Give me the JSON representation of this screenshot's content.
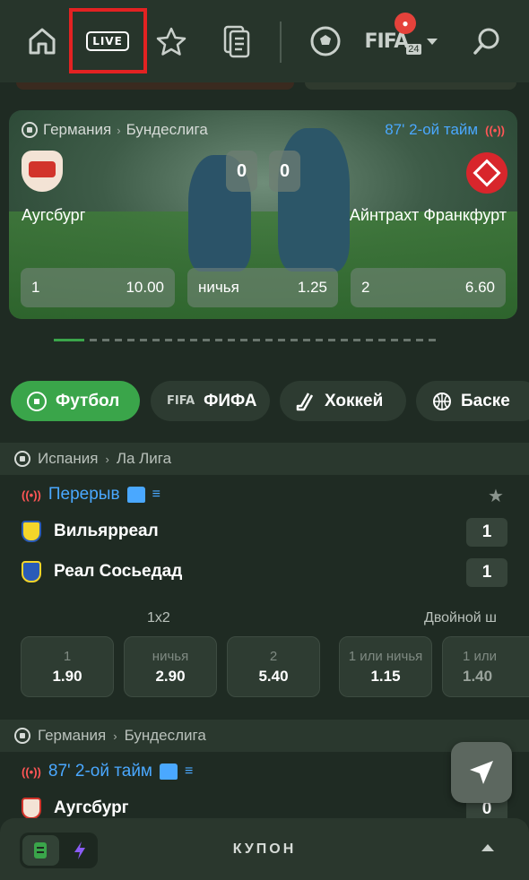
{
  "nav": {
    "live_label": "LIVE",
    "fifa_label": "FIFA",
    "fifa_year": "24"
  },
  "featured": {
    "country": "Германия",
    "league": "Бундеслига",
    "status": "87' 2-ой тайм",
    "home_team": "Аугсбург",
    "away_team": "Айнтрахт Франкфурт",
    "home_score": "0",
    "away_score": "0",
    "odds": [
      {
        "label": "1",
        "value": "10.00"
      },
      {
        "label": "ничья",
        "value": "1.25"
      },
      {
        "label": "2",
        "value": "6.60"
      }
    ]
  },
  "sport_tabs": [
    {
      "label": "Футбол",
      "active": true
    },
    {
      "label": "ФИФА",
      "active": false
    },
    {
      "label": "Хоккей",
      "active": false
    },
    {
      "label": "Баске",
      "active": false
    }
  ],
  "match1": {
    "country": "Испания",
    "league": "Ла Лига",
    "status": "Перерыв",
    "home_team": "Вильярреал",
    "away_team": "Реал Сосьедад",
    "home_score": "1",
    "away_score": "1",
    "market1_title": "1x2",
    "market2_title": "Двойной ш",
    "bets": [
      {
        "label": "1",
        "value": "1.90"
      },
      {
        "label": "ничья",
        "value": "2.90"
      },
      {
        "label": "2",
        "value": "5.40"
      },
      {
        "label": "1 или ничья",
        "value": "1.15"
      },
      {
        "label": "1 или",
        "value": "1.40"
      }
    ]
  },
  "match2": {
    "country": "Германия",
    "league": "Бундеслига",
    "status": "87' 2-ой тайм",
    "home_team": "Аугсбург",
    "home_score": "0"
  },
  "coupon": {
    "label": "КУПОН"
  },
  "colors": {
    "accent_green": "#3aa54a",
    "live_blue": "#4aa8ff",
    "highlight_red": "#e32222"
  }
}
